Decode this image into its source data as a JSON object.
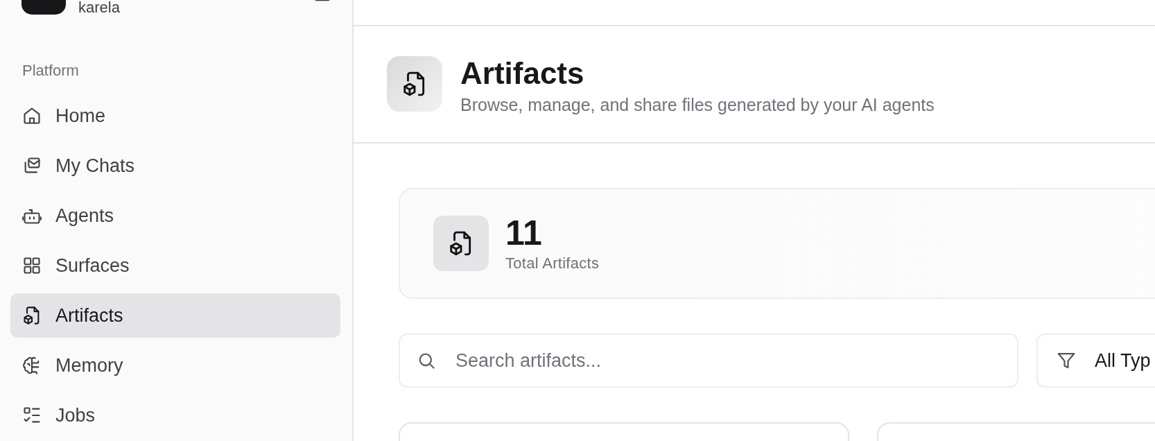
{
  "sidebar": {
    "workspace": "karela",
    "section_label": "Platform",
    "items": [
      {
        "label": "Home",
        "selected": false
      },
      {
        "label": "My Chats",
        "selected": false
      },
      {
        "label": "Agents",
        "selected": false
      },
      {
        "label": "Surfaces",
        "selected": false
      },
      {
        "label": "Artifacts",
        "selected": true
      },
      {
        "label": "Memory",
        "selected": false
      },
      {
        "label": "Jobs",
        "selected": false
      }
    ]
  },
  "page": {
    "title": "Artifacts",
    "subtitle": "Browse, manage, and share files generated by your AI agents"
  },
  "stats": [
    {
      "value": "11",
      "label": "Total Artifacts"
    }
  ],
  "search": {
    "placeholder": "Search artifacts..."
  },
  "type_filter": {
    "value": "All Typ"
  }
}
